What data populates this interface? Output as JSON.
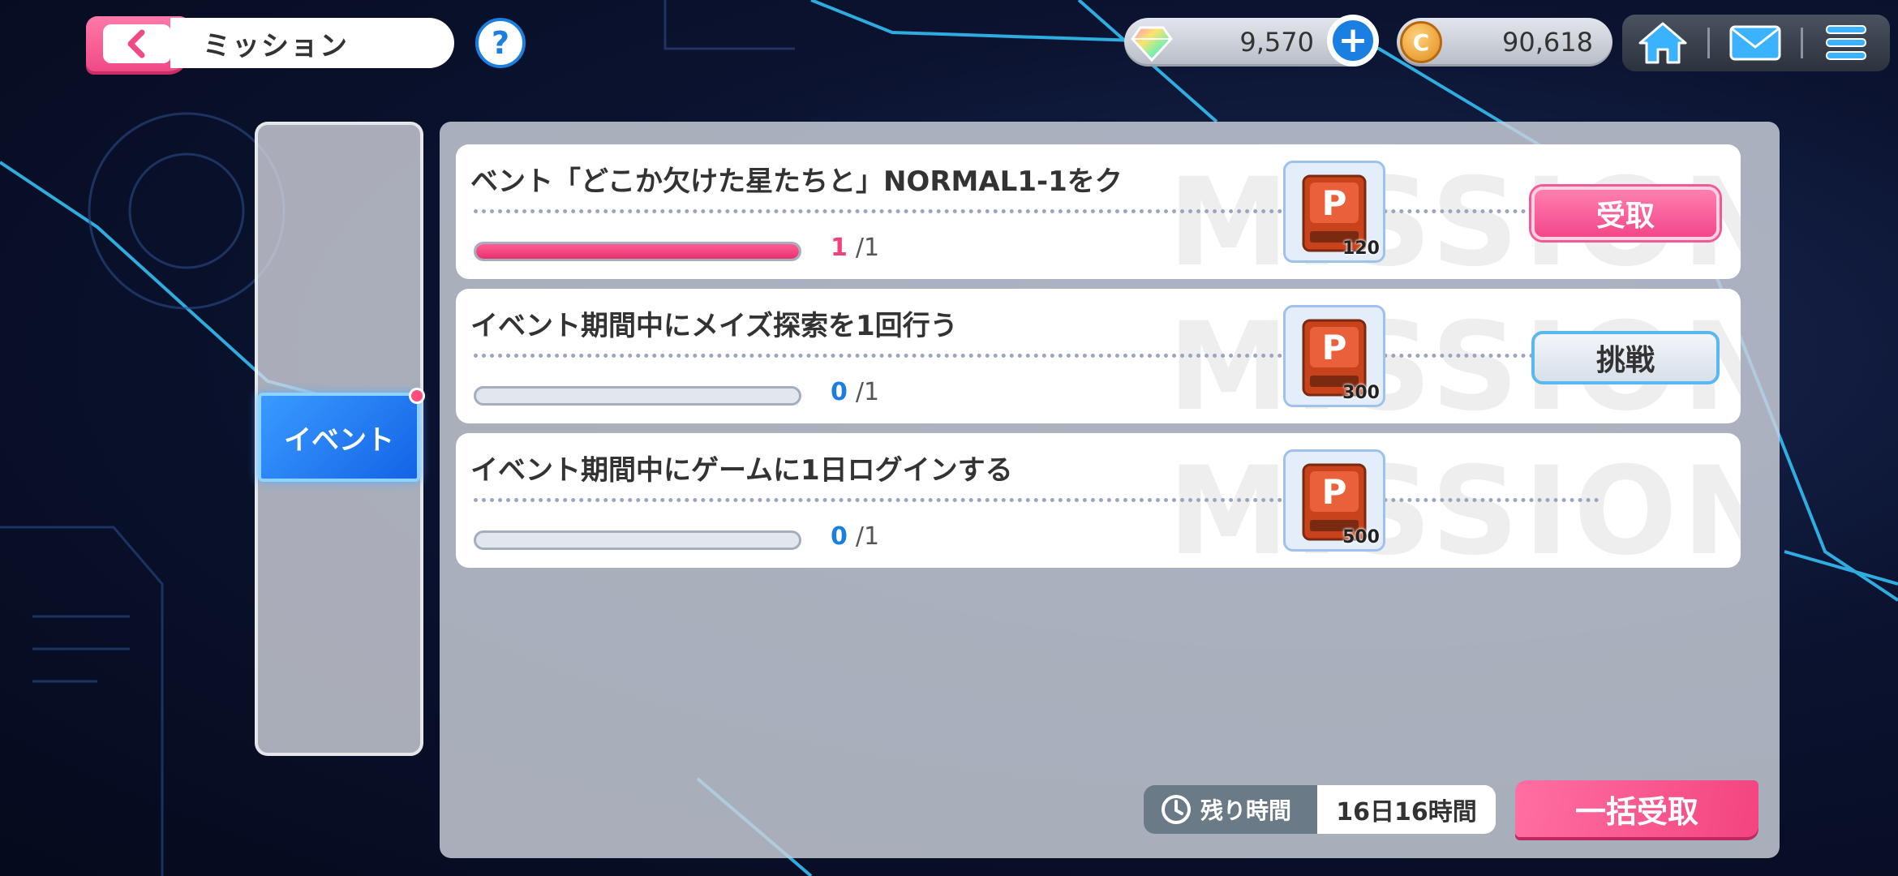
{
  "header": {
    "title": "ミッション",
    "help_label": "?"
  },
  "currency": {
    "gems": "9,570",
    "coins": "90,618",
    "coin_glyph": "C"
  },
  "category": {
    "active_tab": "イベント"
  },
  "watermark": "MISSION",
  "missions": [
    {
      "title": "ベント「どこか欠けた星たちと」NORMAL1-1をク",
      "progress_current": "1",
      "progress_total": "/1",
      "progress_fraction": 1.0,
      "reward_icon": "P",
      "reward_count": "120",
      "action": "受取"
    },
    {
      "title": "イベント期間中にメイズ探索を1回行う",
      "progress_current": "0",
      "progress_total": "/1",
      "progress_fraction": 0,
      "reward_icon": "P",
      "reward_count": "300",
      "action": "挑戦"
    },
    {
      "title": "イベント期間中にゲームに1日ログインする",
      "progress_current": "0",
      "progress_total": "/1",
      "progress_fraction": 0,
      "reward_icon": "P",
      "reward_count": "500",
      "action": ""
    }
  ],
  "footer": {
    "remaining_label": "残り時間",
    "remaining_value": "16日16時間",
    "bulk_claim_label": "一括受取"
  },
  "colors": {
    "accent_pink": "#f3447f",
    "accent_blue": "#1a7fe0"
  }
}
